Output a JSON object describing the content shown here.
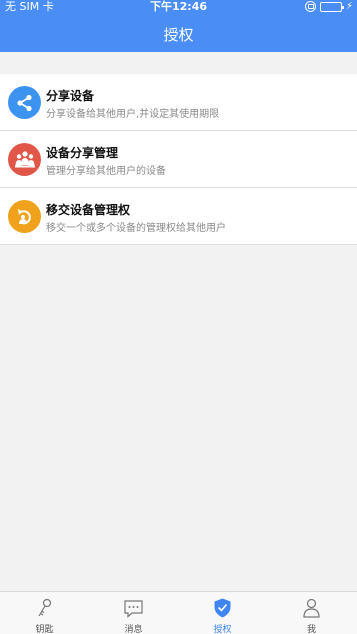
{
  "status_bar": {
    "carrier": "无 SIM 卡",
    "time": "下午12:46"
  },
  "header": {
    "title": "授权"
  },
  "items": [
    {
      "title": "分享设备",
      "description": "分享设备给其他用户,并设定其使用期限",
      "icon": "share-icon",
      "color": "#3d93f0"
    },
    {
      "title": "设备分享管理",
      "description": "管理分享给其他用户的设备",
      "icon": "users-group-icon",
      "color": "#e0574a"
    },
    {
      "title": "移交设备管理权",
      "description": "移交一个或多个设备的管理权给其他用户",
      "icon": "transfer-icon",
      "color": "#f0a21c"
    }
  ],
  "tabbar": {
    "tabs": [
      {
        "label": "钥匙",
        "icon": "key-icon"
      },
      {
        "label": "消息",
        "icon": "message-icon"
      },
      {
        "label": "授权",
        "icon": "shield-check-icon",
        "active": true
      },
      {
        "label": "我",
        "icon": "person-icon"
      }
    ],
    "active_color": "#3f86f3"
  },
  "colors": {
    "header": "#4a8ef5",
    "background": "#f2f2f2"
  }
}
